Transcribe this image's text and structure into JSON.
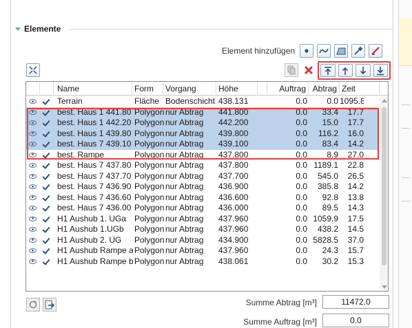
{
  "section": {
    "title": "Elemente"
  },
  "toolbar": {
    "add_label": "Element hinzufügen",
    "add_buttons": [
      "point-icon",
      "line-icon",
      "area-icon",
      "pipette-icon",
      "edit-icon"
    ],
    "move_buttons": [
      "move-top-icon",
      "move-up-icon",
      "move-down-icon",
      "move-bottom-icon"
    ]
  },
  "table": {
    "headers": {
      "name": "Name",
      "form": "Form",
      "vorgang": "Vorgang",
      "hoehe": "Höhe",
      "auftrag": "Auftrag",
      "abtrag": "Abtrag",
      "zeit": "Zeit"
    },
    "rows": [
      {
        "name": "Terrain",
        "form": "Fläche",
        "vorgang": "Bodenschicht",
        "hoehe": "438.131",
        "auftrag": "0.0",
        "abtrag": "0.0",
        "zeit": "1095.8",
        "selected": false
      },
      {
        "name": "best. Haus 1 441.80",
        "form": "Polygon",
        "vorgang": "nur Abtrag",
        "hoehe": "441.800",
        "auftrag": "0.0",
        "abtrag": "33.4",
        "zeit": "17.7",
        "selected": true
      },
      {
        "name": "best. Haus 1 442.20",
        "form": "Polygon",
        "vorgang": "nur Abtrag",
        "hoehe": "442.200",
        "auftrag": "0.0",
        "abtrag": "15.0",
        "zeit": "17.7",
        "selected": true
      },
      {
        "name": "best. Haus 1 439.80",
        "form": "Polygon",
        "vorgang": "nur Abtrag",
        "hoehe": "439.800",
        "auftrag": "0.0",
        "abtrag": "116.2",
        "zeit": "16.0",
        "selected": true
      },
      {
        "name": "best. Haus 7 439.10",
        "form": "Polygon",
        "vorgang": "nur Abtrag",
        "hoehe": "439.100",
        "auftrag": "0.0",
        "abtrag": "83.4",
        "zeit": "14.2",
        "selected": true
      },
      {
        "name": "best. Rampe",
        "form": "Polygon",
        "vorgang": "nur Abtrag",
        "hoehe": "437.800",
        "auftrag": "0.0",
        "abtrag": "8.9",
        "zeit": "27.0",
        "selected": false
      },
      {
        "name": "best. Haus 7 437.80",
        "form": "Polygon",
        "vorgang": "nur Abtrag",
        "hoehe": "437.800",
        "auftrag": "0.0",
        "abtrag": "1189.1",
        "zeit": "22.8",
        "selected": false
      },
      {
        "name": "best. Haus 7 437.70",
        "form": "Polygon",
        "vorgang": "nur Abtrag",
        "hoehe": "437.700",
        "auftrag": "0.0",
        "abtrag": "545.0",
        "zeit": "26.5",
        "selected": false
      },
      {
        "name": "best. Haus 7 436.90",
        "form": "Polygon",
        "vorgang": "nur Abtrag",
        "hoehe": "436.900",
        "auftrag": "0.0",
        "abtrag": "385.8",
        "zeit": "14.2",
        "selected": false
      },
      {
        "name": "best. Haus 7 436.60",
        "form": "Polygon",
        "vorgang": "nur Abtrag",
        "hoehe": "436.600",
        "auftrag": "0.0",
        "abtrag": "92.8",
        "zeit": "13.8",
        "selected": false
      },
      {
        "name": "best. Haus 7 436.00",
        "form": "Polygon",
        "vorgang": "nur Abtrag",
        "hoehe": "436.000",
        "auftrag": "0.0",
        "abtrag": "89.5",
        "zeit": "14.3",
        "selected": false
      },
      {
        "name": "H1 Aushub 1. UGa",
        "form": "Polygon",
        "vorgang": "nur Abtrag",
        "hoehe": "437.960",
        "auftrag": "0.0",
        "abtrag": "1059.9",
        "zeit": "17.5",
        "selected": false
      },
      {
        "name": "H1 Aushub 1.UGb",
        "form": "Polygon",
        "vorgang": "nur Abtrag",
        "hoehe": "437.960",
        "auftrag": "0.0",
        "abtrag": "438.2",
        "zeit": "14.5",
        "selected": false
      },
      {
        "name": "H1 Aushub 2. UG",
        "form": "Polygon",
        "vorgang": "nur Abtrag",
        "hoehe": "434.900",
        "auftrag": "0.0",
        "abtrag": "5828.5",
        "zeit": "37.0",
        "selected": false
      },
      {
        "name": "H1 Aushub Rampe a",
        "form": "Polygon",
        "vorgang": "nur Abtrag",
        "hoehe": "437.960",
        "auftrag": "0.0",
        "abtrag": "24.3",
        "zeit": "15.7",
        "selected": false
      },
      {
        "name": "H1 Aushub Rampe b",
        "form": "Polygon",
        "vorgang": "nur Abtrag",
        "hoehe": "438.061",
        "auftrag": "0.0",
        "abtrag": "30.2",
        "zeit": "15.3",
        "selected": false
      }
    ]
  },
  "summary": {
    "abtrag_label": "Summe Abtrag [m³]",
    "abtrag_value": "11472.0",
    "auftrag_label": "Summe Auftrag [m³]",
    "auftrag_value": "0.0"
  },
  "colors": {
    "selection": "#bcd2ea",
    "highlight": "#e0403e"
  }
}
